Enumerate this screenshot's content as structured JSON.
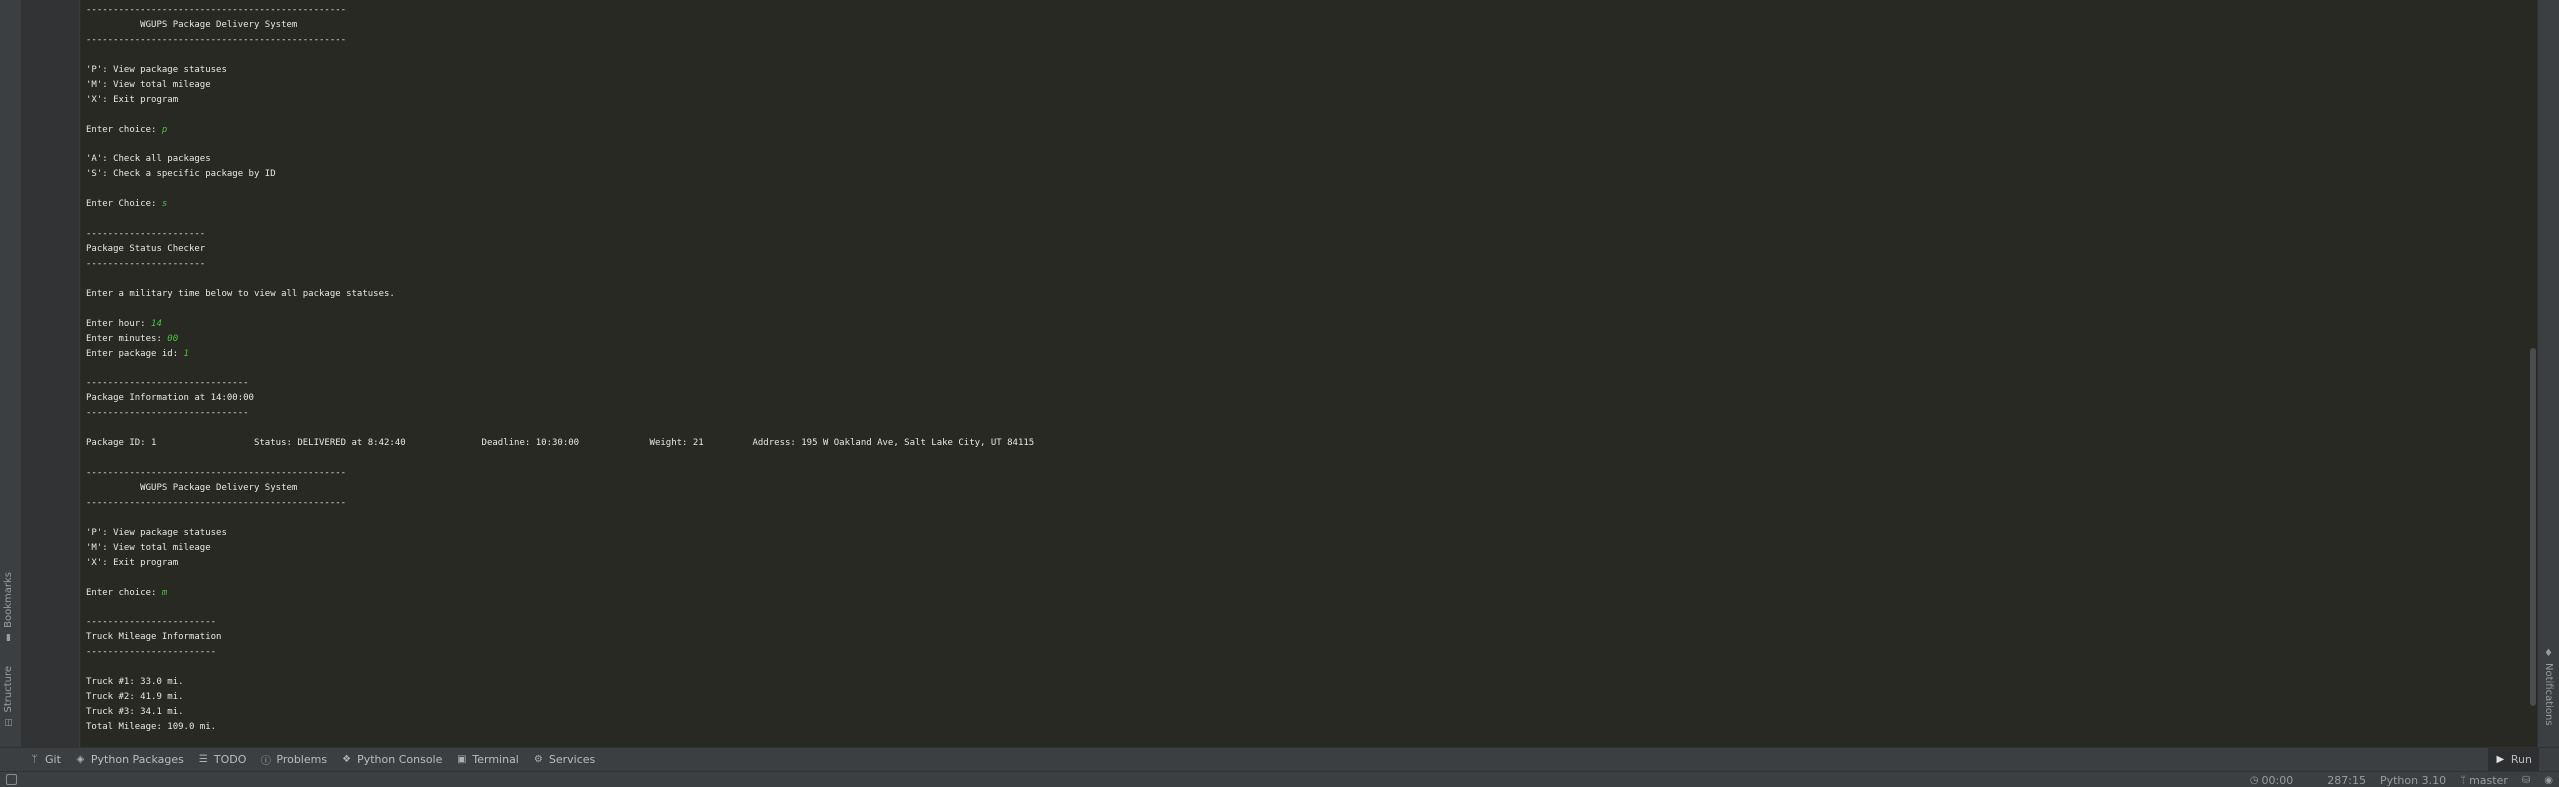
{
  "left_strip": {
    "structure_label": "Structure",
    "bookmarks_label": "Bookmarks"
  },
  "right_strip": {
    "notifications_label": "Notifications"
  },
  "console": {
    "input_color": "#47c23b",
    "lines": [
      {
        "text": "------------------------------------------------"
      },
      {
        "text": "          WGUPS Package Delivery System"
      },
      {
        "text": "------------------------------------------------"
      },
      {
        "text": ""
      },
      {
        "text": "'P': View package statuses"
      },
      {
        "text": "'M': View total mileage"
      },
      {
        "text": "'X': Exit program"
      },
      {
        "text": ""
      },
      {
        "text": "Enter choice: ",
        "input": "p"
      },
      {
        "text": ""
      },
      {
        "text": "'A': Check all packages"
      },
      {
        "text": "'S': Check a specific package by ID"
      },
      {
        "text": ""
      },
      {
        "text": "Enter Choice: ",
        "input": "s"
      },
      {
        "text": ""
      },
      {
        "text": "----------------------"
      },
      {
        "text": "Package Status Checker"
      },
      {
        "text": "----------------------"
      },
      {
        "text": ""
      },
      {
        "text": "Enter a military time below to view all package statuses."
      },
      {
        "text": ""
      },
      {
        "text": "Enter hour: ",
        "input": "14"
      },
      {
        "text": "Enter minutes: ",
        "input": "00"
      },
      {
        "text": "Enter package id: ",
        "input": "1"
      },
      {
        "text": ""
      },
      {
        "text": "------------------------------"
      },
      {
        "text": "Package Information at 14:00:00"
      },
      {
        "text": "------------------------------"
      },
      {
        "text": ""
      },
      {
        "text": "Package ID: 1                  Status: DELIVERED at 8:42:40              Deadline: 10:30:00             Weight: 21         Address: 195 W Oakland Ave, Salt Lake City, UT 84115"
      },
      {
        "text": ""
      },
      {
        "text": "------------------------------------------------"
      },
      {
        "text": "          WGUPS Package Delivery System"
      },
      {
        "text": "------------------------------------------------"
      },
      {
        "text": ""
      },
      {
        "text": "'P': View package statuses"
      },
      {
        "text": "'M': View total mileage"
      },
      {
        "text": "'X': Exit program"
      },
      {
        "text": ""
      },
      {
        "text": "Enter choice: ",
        "input": "m"
      },
      {
        "text": ""
      },
      {
        "text": "------------------------"
      },
      {
        "text": "Truck Mileage Information"
      },
      {
        "text": "------------------------"
      },
      {
        "text": ""
      },
      {
        "text": "Truck #1: 33.0 mi."
      },
      {
        "text": "Truck #2: 41.9 mi."
      },
      {
        "text": "Truck #3: 34.1 mi."
      },
      {
        "text": "Total Mileage: 109.0 mi."
      }
    ]
  },
  "tool_windows": [
    {
      "name": "git",
      "icon": "git-branch-icon",
      "glyph": "ᛘ",
      "label": "Git"
    },
    {
      "name": "python-packages",
      "icon": "layers-icon",
      "glyph": "◈",
      "label": "Python Packages"
    },
    {
      "name": "todo",
      "icon": "list-icon",
      "glyph": "☰",
      "label": "TODO"
    },
    {
      "name": "problems",
      "icon": "info-icon",
      "glyph": "ⓘ",
      "label": "Problems"
    },
    {
      "name": "python-console",
      "icon": "python-icon",
      "glyph": "❖",
      "label": "Python Console"
    },
    {
      "name": "terminal",
      "icon": "terminal-icon",
      "glyph": "▣",
      "label": "Terminal"
    },
    {
      "name": "services",
      "icon": "services-icon",
      "glyph": "⚙",
      "label": "Services"
    }
  ],
  "run_tab": {
    "icon": "play-icon",
    "glyph": "▶",
    "label": "Run"
  },
  "status_bar": {
    "timer": "00:00",
    "caret_position": "287:15",
    "interpreter": "Python 3.10",
    "branch": "master"
  }
}
